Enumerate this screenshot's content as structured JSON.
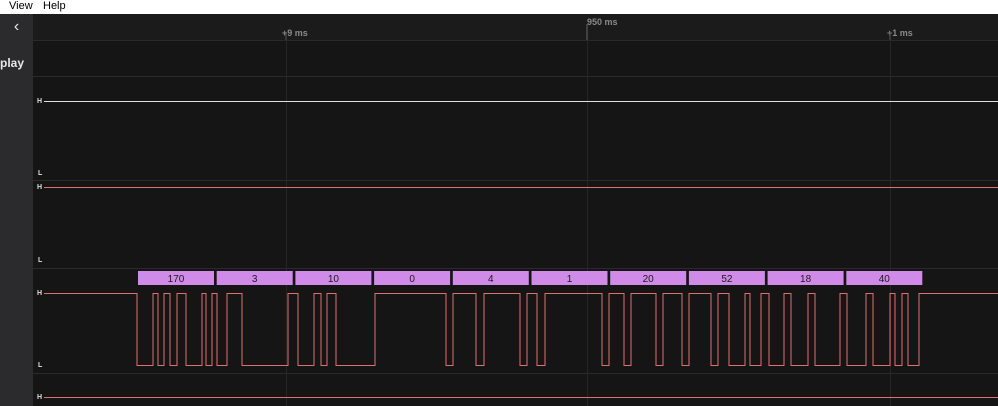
{
  "menu": {
    "items": [
      "View",
      "Help"
    ]
  },
  "sidebar": {
    "partial_label": "play"
  },
  "ruler": {
    "labels": [
      {
        "text": "+9 ms",
        "pos": "minor"
      },
      {
        "text": "950 ms",
        "pos": "major"
      },
      {
        "text": "+1 ms",
        "pos": "minor"
      }
    ]
  },
  "trace": {
    "high_label": "H",
    "low_label": "L",
    "signal_color": "#e07070",
    "channel0_color": "#e0e0e0",
    "decode_color": "#d08ae8"
  },
  "decoder": {
    "values": [
      "170",
      "3",
      "10",
      "0",
      "4",
      "1",
      "20",
      "52",
      "18",
      "40"
    ]
  }
}
